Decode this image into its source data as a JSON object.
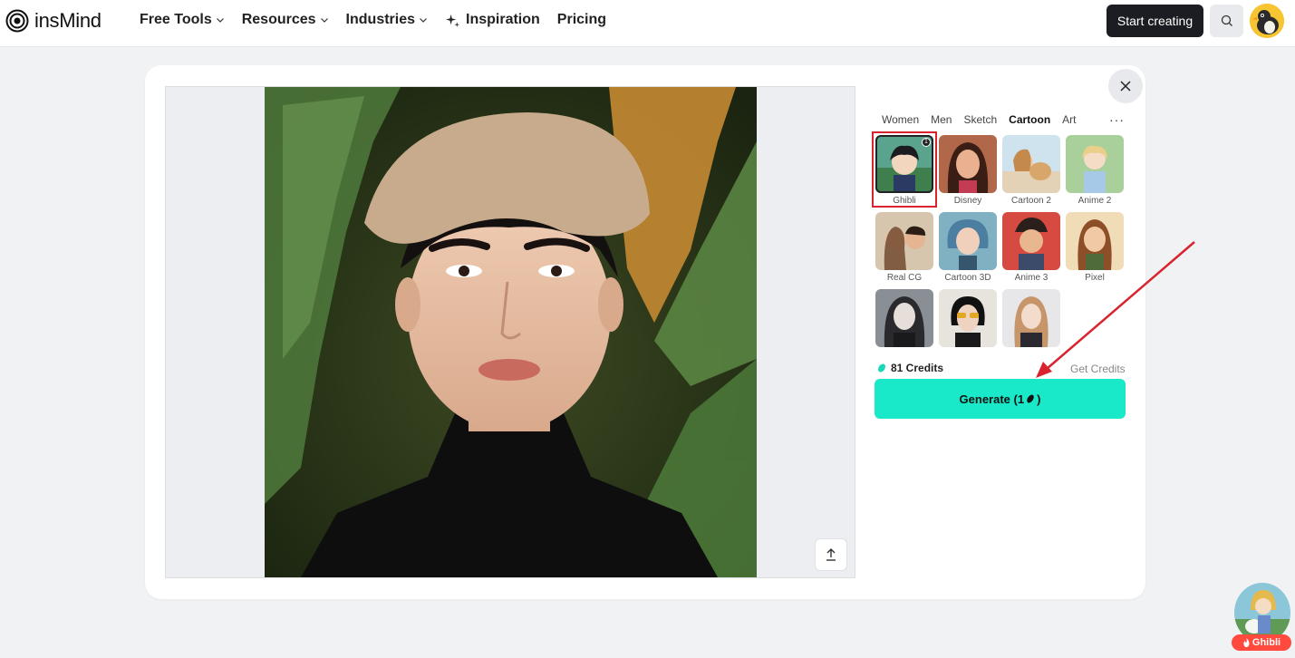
{
  "brand": {
    "name": "insMind"
  },
  "nav": {
    "items": [
      {
        "label": "Free Tools",
        "has_dropdown": true
      },
      {
        "label": "Resources",
        "has_dropdown": true
      },
      {
        "label": "Industries",
        "has_dropdown": true
      },
      {
        "label": "Inspiration",
        "has_dropdown": false,
        "icon": "sparkle-icon"
      },
      {
        "label": "Pricing",
        "has_dropdown": false
      }
    ],
    "cta_label": "Start creating",
    "search_icon": "search-icon"
  },
  "editor": {
    "categories": [
      {
        "label": "Women",
        "active": false
      },
      {
        "label": "Men",
        "active": false
      },
      {
        "label": "Sketch",
        "active": false
      },
      {
        "label": "Cartoon",
        "active": true
      },
      {
        "label": "Art",
        "active": false
      }
    ],
    "more_label": "···",
    "styles": [
      {
        "label": "Ghibli",
        "selected": true,
        "badge": "1"
      },
      {
        "label": "Disney",
        "selected": false
      },
      {
        "label": "Cartoon 2",
        "selected": false
      },
      {
        "label": "Anime 2",
        "selected": false
      },
      {
        "label": "Real CG",
        "selected": false
      },
      {
        "label": "Cartoon 3D",
        "selected": false
      },
      {
        "label": "Anime 3",
        "selected": false
      },
      {
        "label": "Pixel",
        "selected": false
      },
      {
        "label": "",
        "selected": false
      },
      {
        "label": "",
        "selected": false
      },
      {
        "label": "",
        "selected": false
      }
    ],
    "credits_label": "81 Credits",
    "get_credits_label": "Get Credits",
    "generate": {
      "label": "Generate (1",
      "suffix": ")"
    }
  },
  "floating_widget": {
    "label": "Ghibli"
  },
  "colors": {
    "accent": "#19e9c8",
    "annotation_red": "#d9232e",
    "cta_dark": "#1c1d22",
    "page_bg": "#f1f2f4"
  }
}
